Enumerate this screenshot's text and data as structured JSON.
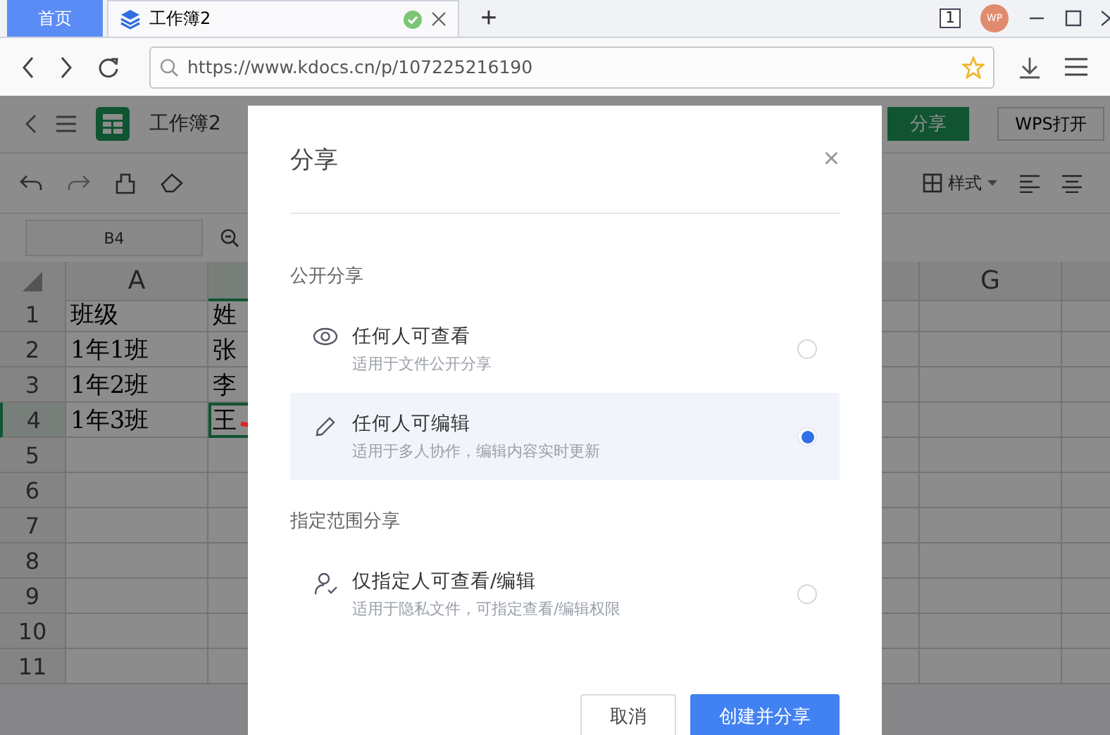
{
  "browser": {
    "tabs": [
      {
        "kind": "home",
        "label": "首页",
        "selected": false
      },
      {
        "kind": "doc",
        "label": "工作簿2",
        "selected": true
      }
    ],
    "new_tab": "+",
    "tab_count": "1",
    "avatar": "WP",
    "url": "https://www.kdocs.cn/p/107225216190"
  },
  "sheet": {
    "title": "工作簿2",
    "share_button": "分享",
    "open_button": "WPS打开",
    "style_menu": "样式",
    "name_box": "B4",
    "columns": [
      "A",
      "G"
    ],
    "rows": [
      {
        "number": "1",
        "cells": [
          "班级",
          "姓"
        ],
        "selected": false
      },
      {
        "number": "2",
        "cells": [
          "1年1班",
          "张"
        ],
        "selected": false
      },
      {
        "number": "3",
        "cells": [
          "1年2班",
          "李"
        ],
        "selected": false
      },
      {
        "number": "4",
        "cells": [
          "1年3班",
          "王"
        ],
        "selected": true
      },
      {
        "number": "5",
        "cells": [],
        "selected": false
      },
      {
        "number": "6",
        "cells": [],
        "selected": false
      },
      {
        "number": "7",
        "cells": [],
        "selected": false
      },
      {
        "number": "8",
        "cells": [],
        "selected": false
      },
      {
        "number": "9",
        "cells": [],
        "selected": false
      },
      {
        "number": "10",
        "cells": [],
        "selected": false
      },
      {
        "number": "11",
        "cells": [],
        "selected": false
      }
    ]
  },
  "dialog": {
    "title": "分享",
    "close": "×",
    "sections": [
      {
        "heading": "公开分享",
        "options": [
          {
            "kind": "view",
            "title": "任何人可查看",
            "description": "适用于文件公开分享",
            "selected": false
          },
          {
            "kind": "edit",
            "title": "任何人可编辑",
            "description": "适用于多人协作，编辑内容实时更新",
            "selected": true
          }
        ]
      },
      {
        "heading": "指定范围分享",
        "options": [
          {
            "kind": "restricted",
            "title": "仅指定人可查看/编辑",
            "description": "适用于隐私文件，可指定查看/编辑权限",
            "selected": false
          }
        ]
      }
    ],
    "buttons": [
      {
        "kind": "secondary",
        "label": "取消"
      },
      {
        "kind": "primary",
        "label": "创建并分享"
      }
    ]
  }
}
